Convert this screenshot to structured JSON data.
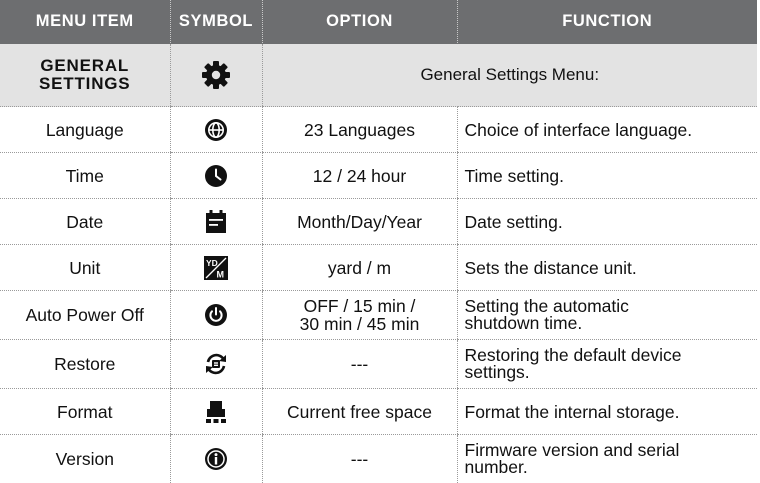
{
  "headers": {
    "menu_item": "MENU ITEM",
    "symbol": "SYMBOL",
    "option": "OPTION",
    "function": "FUNCTION"
  },
  "section": {
    "title_line1": "GENERAL",
    "title_line2": "SETTINGS",
    "icon": "gear-icon",
    "description": "General Settings Menu:"
  },
  "rows": [
    {
      "item": "Language",
      "icon": "globe-icon",
      "option": "23 Languages",
      "function": "Choice of interface language."
    },
    {
      "item": "Time",
      "icon": "clock-icon",
      "option": "12 / 24 hour",
      "function": "Time setting."
    },
    {
      "item": "Date",
      "icon": "calendar-icon",
      "option": "Month/Day/Year",
      "function": "Date setting."
    },
    {
      "item": "Unit",
      "icon": "yard-meter-icon",
      "icon_text_top": "YD",
      "icon_text_bottom": "M",
      "option": "yard / m",
      "function": "Sets the distance unit."
    },
    {
      "item": "Auto Power Off",
      "icon": "power-icon",
      "option_line1": "OFF / 15 min /",
      "option_line2": "30 min / 45 min",
      "function_line1": "Setting the automatic",
      "function_line2": "shutdown time."
    },
    {
      "item": "Restore",
      "icon": "restore-icon",
      "option": "---",
      "function_line1": "Restoring the default device",
      "function_line2": "settings."
    },
    {
      "item": "Format",
      "icon": "format-icon",
      "option": "Current free space",
      "function": "Format the internal storage."
    },
    {
      "item": "Version",
      "icon": "info-icon",
      "option": "---",
      "function_line1": "Firmware version and serial",
      "function_line2": "number."
    }
  ],
  "colors": {
    "header_bg": "#6d6e70",
    "section_bg": "#e3e3e3",
    "icon": "#111111"
  }
}
